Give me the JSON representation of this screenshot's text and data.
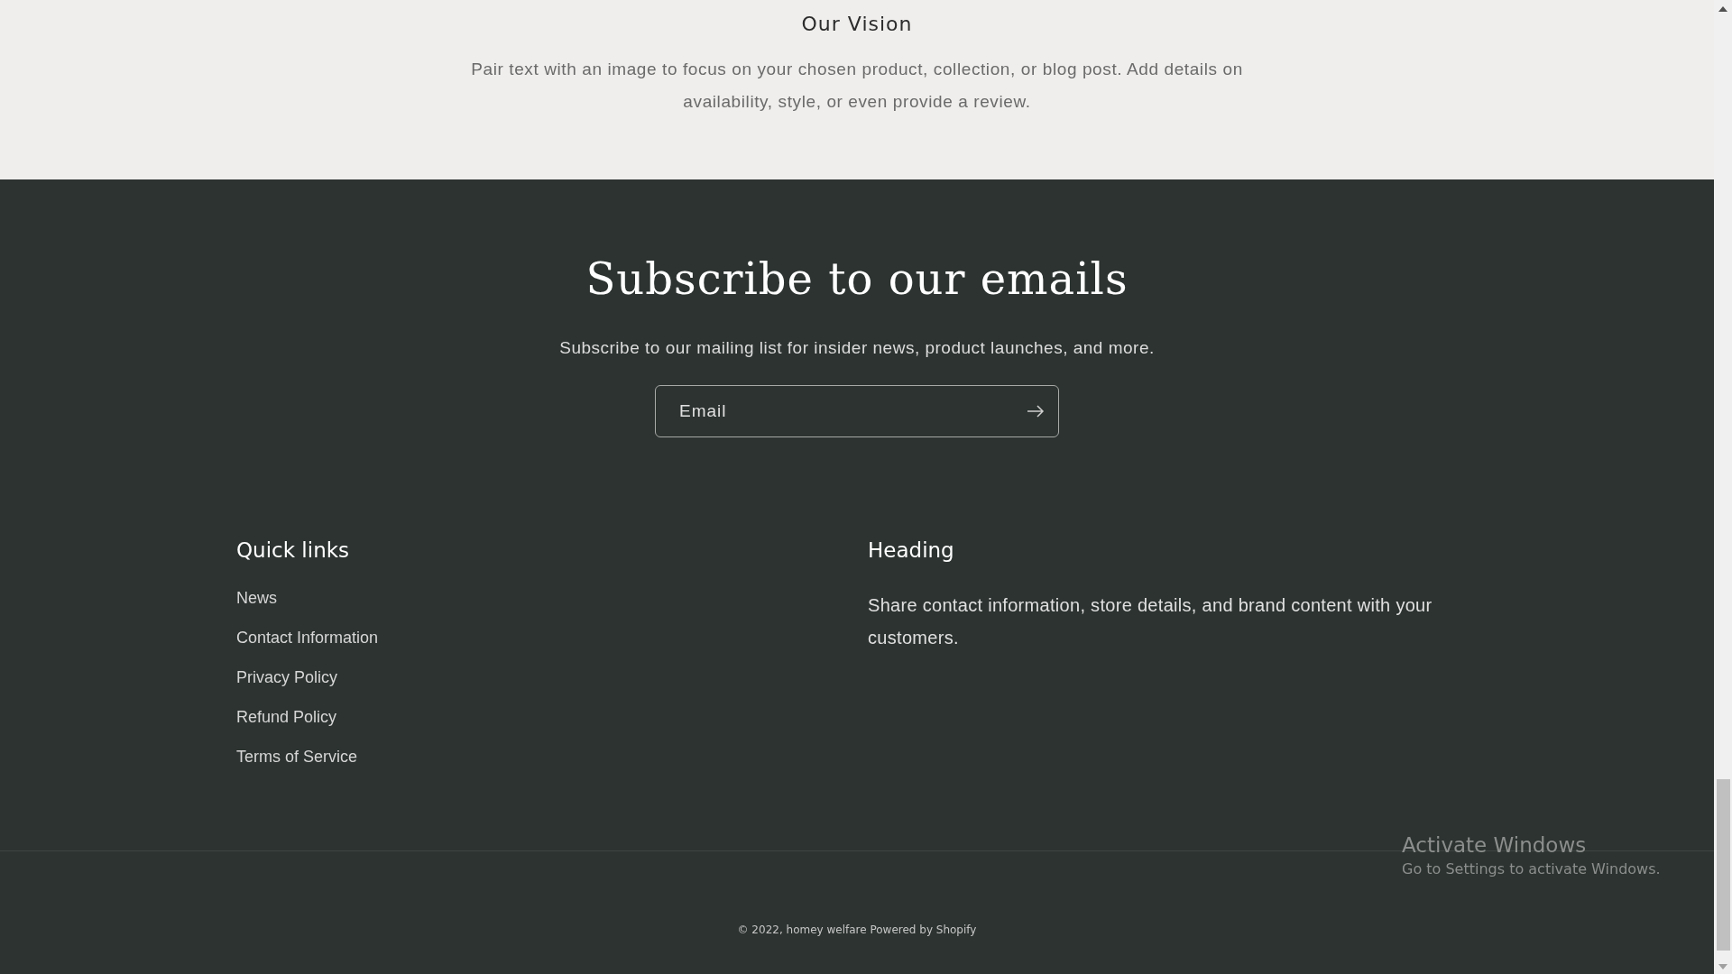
{
  "vision": {
    "title": "Our Vision",
    "text": "Pair text with an image to focus on your chosen product, collection, or blog post. Add details on availability, style, or even provide a review."
  },
  "newsletter": {
    "title": "Subscribe to our emails",
    "text": "Subscribe to our mailing list for insider news, product launches, and more.",
    "email": {
      "placeholder": "Email"
    }
  },
  "quick_links": {
    "title": "Quick links",
    "items": [
      "News",
      "Contact Information",
      "Privacy Policy",
      "Refund Policy",
      "Terms of Service"
    ]
  },
  "info": {
    "title": "Heading",
    "text": "Share contact information, store details, and brand content with your customers."
  },
  "copyright": "© 2022, homey welfare Powered by Shopify",
  "activation": {
    "title": "Activate Windows",
    "text": "Go to Settings to activate Windows."
  }
}
